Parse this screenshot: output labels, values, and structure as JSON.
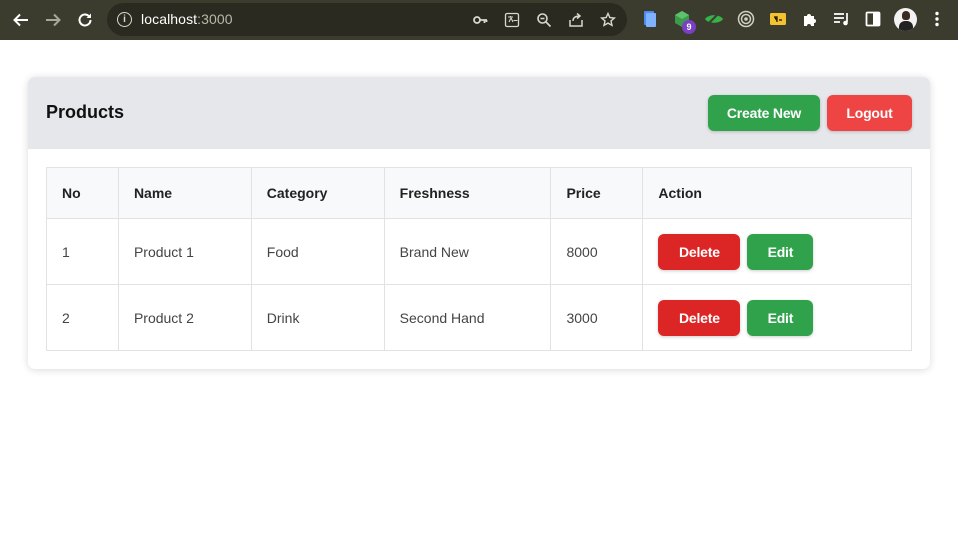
{
  "browser": {
    "url_host": "localhost",
    "url_port": ":3000",
    "extension_badge": "9"
  },
  "header": {
    "title": "Products",
    "create_label": "Create New",
    "logout_label": "Logout"
  },
  "table": {
    "columns": [
      "No",
      "Name",
      "Category",
      "Freshness",
      "Price",
      "Action"
    ],
    "rows": [
      {
        "no": "1",
        "name": "Product 1",
        "category": "Food",
        "freshness": "Brand New",
        "price": "8000",
        "delete_label": "Delete",
        "edit_label": "Edit"
      },
      {
        "no": "2",
        "name": "Product 2",
        "category": "Drink",
        "freshness": "Second Hand",
        "price": "3000",
        "delete_label": "Delete",
        "edit_label": "Edit"
      }
    ]
  },
  "colors": {
    "chrome_bg": "#3c3c2e",
    "header_bg": "#e5e7eb",
    "create_green": "#31a24c",
    "logout_red": "#ef4444",
    "delete_red": "#dc2626"
  },
  "icons": [
    "back-arrow-icon",
    "forward-arrow-icon",
    "reload-icon",
    "info-icon",
    "key-icon",
    "translate-icon",
    "zoom-out-icon",
    "share-icon",
    "star-icon",
    "extension-puzzle-icon",
    "reading-list-icon",
    "side-panel-icon",
    "menu-dots-icon"
  ]
}
